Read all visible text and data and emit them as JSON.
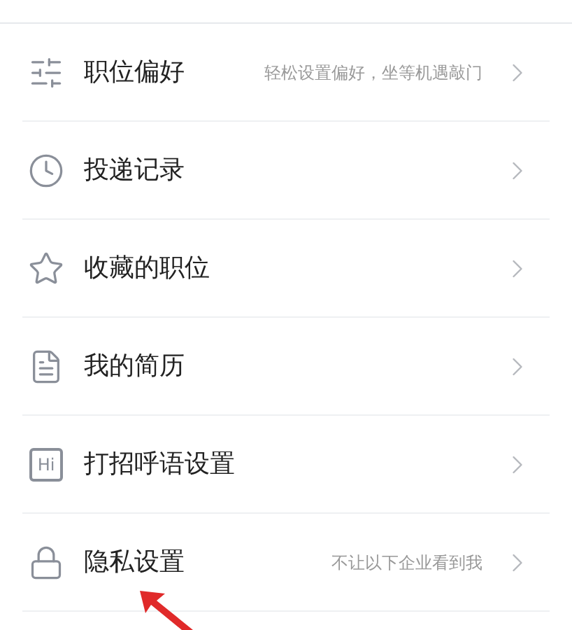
{
  "menu": [
    {
      "kind": "sliders",
      "label": "职位偏好",
      "hint": "轻松设置偏好，坐等机遇敲门"
    },
    {
      "kind": "clock",
      "label": "投递记录"
    },
    {
      "kind": "star",
      "label": "收藏的职位"
    },
    {
      "kind": "resume",
      "label": "我的简历"
    },
    {
      "kind": "badge",
      "icon_text": "Hi",
      "label": "打招呼语设置"
    },
    {
      "kind": "lock",
      "label": "隐私设置",
      "hint": "不让以下企业看到我"
    }
  ]
}
